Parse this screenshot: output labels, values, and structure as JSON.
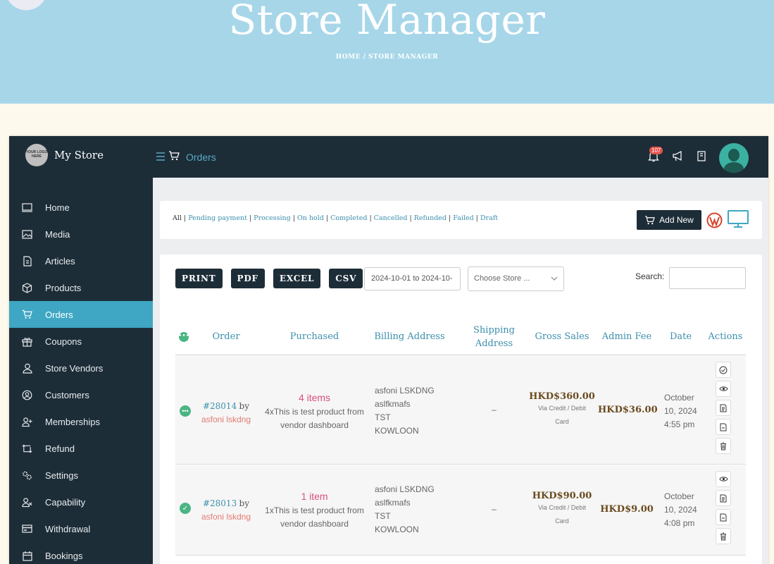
{
  "hero": {
    "title": "Store Manager",
    "breadcrumb": "HOME / STORE MANAGER"
  },
  "topbar": {
    "store_name": "My Store",
    "logo_text": "YOUR LOGO HERE",
    "section": "Orders",
    "notification_count": "107"
  },
  "sidebar": {
    "items": [
      {
        "label": "Home",
        "icon": "monitor-icon"
      },
      {
        "label": "Media",
        "icon": "image-icon"
      },
      {
        "label": "Articles",
        "icon": "document-icon"
      },
      {
        "label": "Products",
        "icon": "box-icon"
      },
      {
        "label": "Orders",
        "icon": "cart-icon",
        "active": true
      },
      {
        "label": "Coupons",
        "icon": "gift-icon"
      },
      {
        "label": "Store Vendors",
        "icon": "user-icon"
      },
      {
        "label": "Customers",
        "icon": "user-circle-icon"
      },
      {
        "label": "Memberships",
        "icon": "user-plus-icon"
      },
      {
        "label": "Refund",
        "icon": "refund-icon"
      },
      {
        "label": "Settings",
        "icon": "gears-icon"
      },
      {
        "label": "Capability",
        "icon": "user-x-icon"
      },
      {
        "label": "Withdrawal",
        "icon": "card-icon"
      },
      {
        "label": "Bookings",
        "icon": "calendar-icon"
      }
    ]
  },
  "filters": {
    "all": "All",
    "links": [
      "Pending payment",
      "Processing",
      "On hold",
      "Completed",
      "Cancelled",
      "Refunded",
      "Failed",
      "Draft"
    ],
    "add_new": "Add New"
  },
  "toolbar": {
    "buttons": [
      "PRINT",
      "PDF",
      "EXCEL",
      "CSV"
    ],
    "date_range": "2024-10-01 to 2024-10-",
    "store_placeholder": "Choose Store ...",
    "search_label": "Search:"
  },
  "table": {
    "headers": {
      "order": "Order",
      "purchased": "Purchased",
      "billing": "Billing Address",
      "shipping_1": "Shipping",
      "shipping_2": "Address",
      "gross": "Gross Sales",
      "fee": "Admin Fee",
      "date": "Date",
      "actions": "Actions"
    },
    "rows": [
      {
        "order": "#28014",
        "by": "by",
        "customer": "asfoni lskdng",
        "items": "4 items",
        "product_1": "4xThis is test product from",
        "product_2": "vendor dashboard",
        "billing_1": "asfoni LSKDNG",
        "billing_2": "aslfkmafs",
        "billing_3": "TST",
        "billing_4": "KOWLOON",
        "shipping": "–",
        "gross": "HKD$360.00",
        "via_1": "Via Credit / Debit",
        "via_2": "Card",
        "fee": "HKD$36.00",
        "date_1": "October",
        "date_2": "10, 2024",
        "date_3": "4:55 pm",
        "status": "processing"
      },
      {
        "order": "#28013",
        "by": "by",
        "customer": "asfoni lskdng",
        "items": "1 item",
        "product_1": "1xThis is test product from",
        "product_2": "vendor dashboard",
        "billing_1": "asfoni LSKDNG",
        "billing_2": "aslfkmafs",
        "billing_3": "TST",
        "billing_4": "KOWLOON",
        "shipping": "–",
        "gross": "HKD$90.00",
        "via_1": "Via Credit / Debit",
        "via_2": "Card",
        "fee": "HKD$9.00",
        "date_1": "October",
        "date_2": "10, 2024",
        "date_3": "4:08 pm",
        "status": "completed"
      }
    ]
  },
  "colors": {
    "sidebar_bg": "#1d2d38",
    "accent": "#3fa7c3",
    "hero_bg": "#a7d6e9",
    "status_green": "#4ab583"
  }
}
